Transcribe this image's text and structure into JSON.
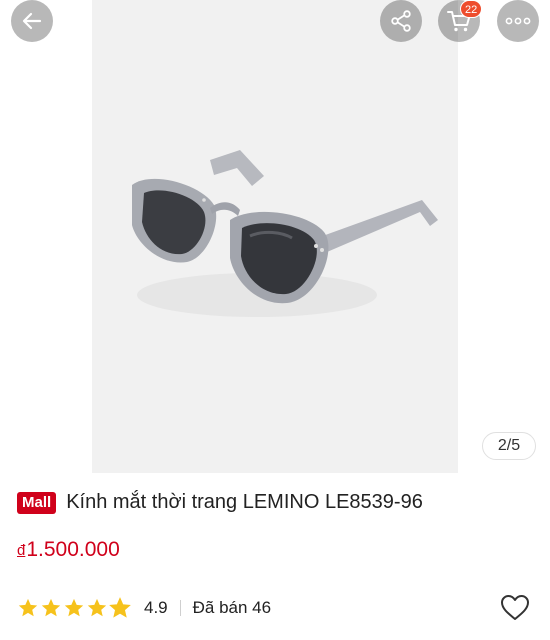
{
  "header": {
    "back_icon": "arrow-left-icon",
    "share_icon": "share-icon",
    "cart_icon": "cart-icon",
    "cart_count": "22",
    "more_icon": "more-horizontal-icon"
  },
  "gallery": {
    "counter": "2/5",
    "image_subject": "sunglasses"
  },
  "product": {
    "mall_badge": "Mall",
    "title": "Kính mắt thời trang LEMINO LE8539-96",
    "currency_symbol": "đ",
    "price": "1.500.000",
    "rating": "4.9",
    "rating_stars_fraction": 0.9,
    "sold": "Đã bán 46",
    "favorite_icon": "heart-outline-icon"
  },
  "colors": {
    "accent_red": "#d0011b",
    "badge_orange": "#ee4d2d",
    "star_yellow": "#f6c21c"
  }
}
